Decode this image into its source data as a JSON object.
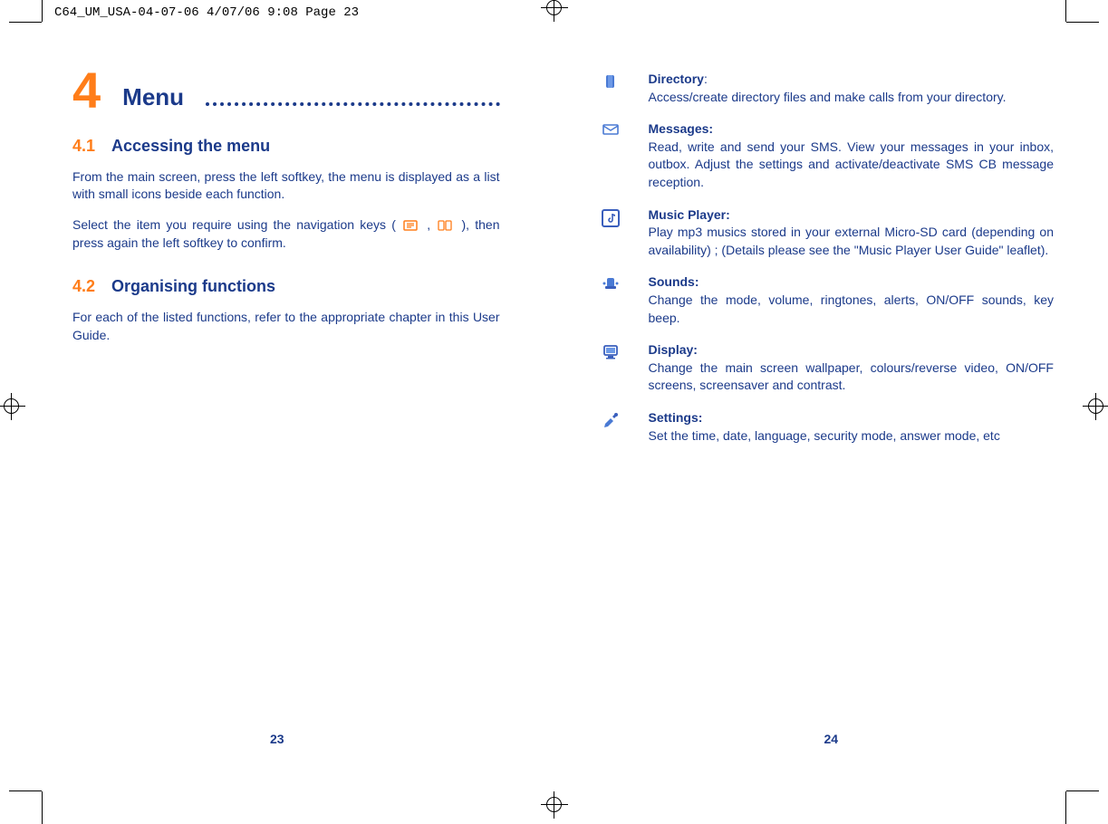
{
  "slug": "C64_UM_USA-04-07-06  4/07/06  9:08  Page 23",
  "left_page_number": "23",
  "right_page_number": "24",
  "chapter": {
    "number": "4",
    "title": "Menu"
  },
  "sections": {
    "s41": {
      "num": "4.1",
      "title": "Accessing the menu",
      "p1": "From the main screen, press the left softkey, the menu is displayed as a list with small icons beside each function.",
      "p2a": "Select the item you require using the navigation keys (",
      "p2b": ",",
      "p2c": "), then press again the left softkey to confirm."
    },
    "s42": {
      "num": "4.2",
      "title": "Organising functions",
      "p1": "For each of the listed functions, refer to the appropriate chapter in this User Guide."
    }
  },
  "menu_items": [
    {
      "id": "directory",
      "title": "Directory",
      "title_suffix": ":",
      "desc": "Access/create directory files and make calls from your directory."
    },
    {
      "id": "messages",
      "title": "Messages:",
      "title_suffix": "",
      "desc": "Read, write and send your SMS. View your messages in your inbox, outbox. Adjust the settings and activate/deactivate SMS CB message reception."
    },
    {
      "id": "music",
      "title": "Music Player:",
      "title_suffix": "",
      "desc": "Play mp3 musics stored in your external Micro-SD card (depending on availability) ; (Details please see the \"Music Player User Guide\" leaflet)."
    },
    {
      "id": "sounds",
      "title": "Sounds:",
      "title_suffix": "",
      "desc": "Change the mode, volume, ringtones, alerts, ON/OFF sounds, key beep."
    },
    {
      "id": "display",
      "title": "Display:",
      "title_suffix": "",
      "desc": "Change the main screen wallpaper, colours/reverse video, ON/OFF screens, screensaver and contrast."
    },
    {
      "id": "settings",
      "title": "Settings:",
      "title_suffix": "",
      "desc": "Set the time, date, language, security mode, answer mode, etc"
    }
  ]
}
